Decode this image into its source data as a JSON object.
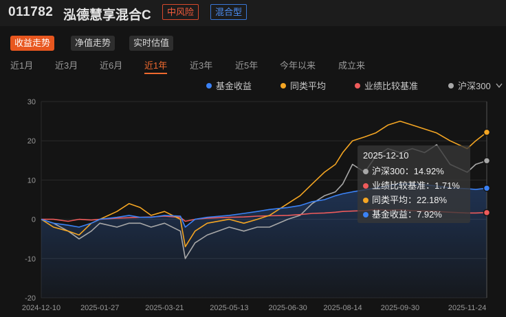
{
  "header": {
    "code": "011782",
    "name": "泓德慧享混合C",
    "risk_tag": "中风险",
    "type_tag": "混合型"
  },
  "view_tabs": [
    {
      "label": "收益走势",
      "active": true
    },
    {
      "label": "净值走势",
      "active": false
    },
    {
      "label": "实时估值",
      "active": false
    }
  ],
  "range_tabs": [
    {
      "label": "近1月",
      "active": false
    },
    {
      "label": "近3月",
      "active": false
    },
    {
      "label": "近6月",
      "active": false
    },
    {
      "label": "近1年",
      "active": true
    },
    {
      "label": "近3年",
      "active": false
    },
    {
      "label": "近5年",
      "active": false
    },
    {
      "label": "今年以来",
      "active": false
    },
    {
      "label": "成立来",
      "active": false
    }
  ],
  "legend": [
    {
      "label": "基金收益",
      "color": "#3b82f6",
      "icon": "dot"
    },
    {
      "label": "同类平均",
      "color": "#f5a623",
      "icon": "dot"
    },
    {
      "label": "业绩比较基准",
      "color": "#ef5b5b",
      "icon": "dot"
    },
    {
      "label": "沪深300",
      "color": "#a8a8a8",
      "icon": "dot",
      "dropdown": "chevron-down-icon"
    }
  ],
  "tooltip": {
    "date": "2025-12-10",
    "rows": [
      {
        "label": "沪深300：14.92%",
        "color": "#a8a8a8"
      },
      {
        "label": "业绩比较基准：1.71%",
        "color": "#ef5b5b"
      },
      {
        "label": "同类平均：22.18%",
        "color": "#f5a623"
      },
      {
        "label": "基金收益：7.92%",
        "color": "#3b82f6"
      }
    ]
  },
  "chart_data": {
    "type": "line",
    "ylim": [
      -20,
      30
    ],
    "y_ticks": [
      "30",
      "20",
      "10",
      "0",
      "-10",
      "-20"
    ],
    "x_ticks": [
      "2024-12-10",
      "2025-01-27",
      "2025-03-21",
      "2025-05-13",
      "2025-06-30",
      "2025-08-14",
      "2025-09-30",
      "2025-11-24"
    ],
    "grid": true,
    "legend_position": "top-right",
    "crosshair_date": "2025-12-10",
    "x_dates": [
      "2024-12-10",
      "2024-12-20",
      "2025-01-01",
      "2025-01-10",
      "2025-01-20",
      "2025-01-27",
      "2025-02-10",
      "2025-02-20",
      "2025-03-01",
      "2025-03-10",
      "2025-03-21",
      "2025-04-03",
      "2025-04-07",
      "2025-04-15",
      "2025-04-25",
      "2025-05-13",
      "2025-05-25",
      "2025-06-05",
      "2025-06-15",
      "2025-06-30",
      "2025-07-10",
      "2025-07-20",
      "2025-07-30",
      "2025-08-08",
      "2025-08-14",
      "2025-08-22",
      "2025-09-01",
      "2025-09-10",
      "2025-09-20",
      "2025-09-30",
      "2025-10-10",
      "2025-10-20",
      "2025-10-30",
      "2025-11-10",
      "2025-11-24",
      "2025-12-01",
      "2025-12-10"
    ],
    "series": [
      {
        "name": "沪深300",
        "color": "#a8a8a8",
        "values": [
          0,
          -1,
          -3,
          -5,
          -3,
          -1,
          -2,
          -1,
          -1,
          -2,
          -1,
          -3,
          -10,
          -6,
          -4,
          -2,
          -3,
          -2,
          -2,
          0,
          1,
          4,
          6,
          7,
          9,
          14,
          12,
          16,
          18,
          17,
          18,
          17,
          19,
          14,
          12,
          14,
          14.92
        ]
      },
      {
        "name": "业绩比较基准",
        "color": "#ef5b5b",
        "values": [
          0,
          0,
          -0.5,
          0,
          -0.2,
          0,
          0.3,
          0.4,
          0.5,
          0.6,
          0.8,
          0.5,
          -0.5,
          0,
          0.3,
          0.5,
          0.6,
          0.8,
          0.9,
          1,
          1.2,
          1.5,
          1.6,
          1.8,
          2,
          2.1,
          2.2,
          2.5,
          2.3,
          2.4,
          2.2,
          2.1,
          2.0,
          1.8,
          1.6,
          1.6,
          1.71
        ]
      },
      {
        "name": "同类平均",
        "color": "#f5a623",
        "values": [
          0,
          -2,
          -3,
          -4,
          -1,
          0,
          2,
          4,
          3,
          1,
          2,
          0,
          -7,
          -3,
          -1,
          0,
          -1,
          0,
          1,
          4,
          6,
          9,
          12,
          14,
          17,
          20,
          21,
          22,
          24,
          25,
          24,
          23,
          22,
          20,
          18,
          20,
          22.18
        ]
      },
      {
        "name": "基金收益",
        "color": "#3b82f6",
        "values": [
          0,
          -1,
          -1.5,
          -2,
          -1,
          0,
          0.5,
          1,
          0.5,
          0.5,
          1,
          0.8,
          -2,
          0,
          0.5,
          1,
          1.5,
          2,
          2.5,
          3,
          3.5,
          4.5,
          5,
          6,
          6.5,
          7,
          7.5,
          8,
          8.5,
          9,
          9,
          8.8,
          8.5,
          8,
          7.8,
          7.6,
          7.92
        ]
      }
    ]
  }
}
